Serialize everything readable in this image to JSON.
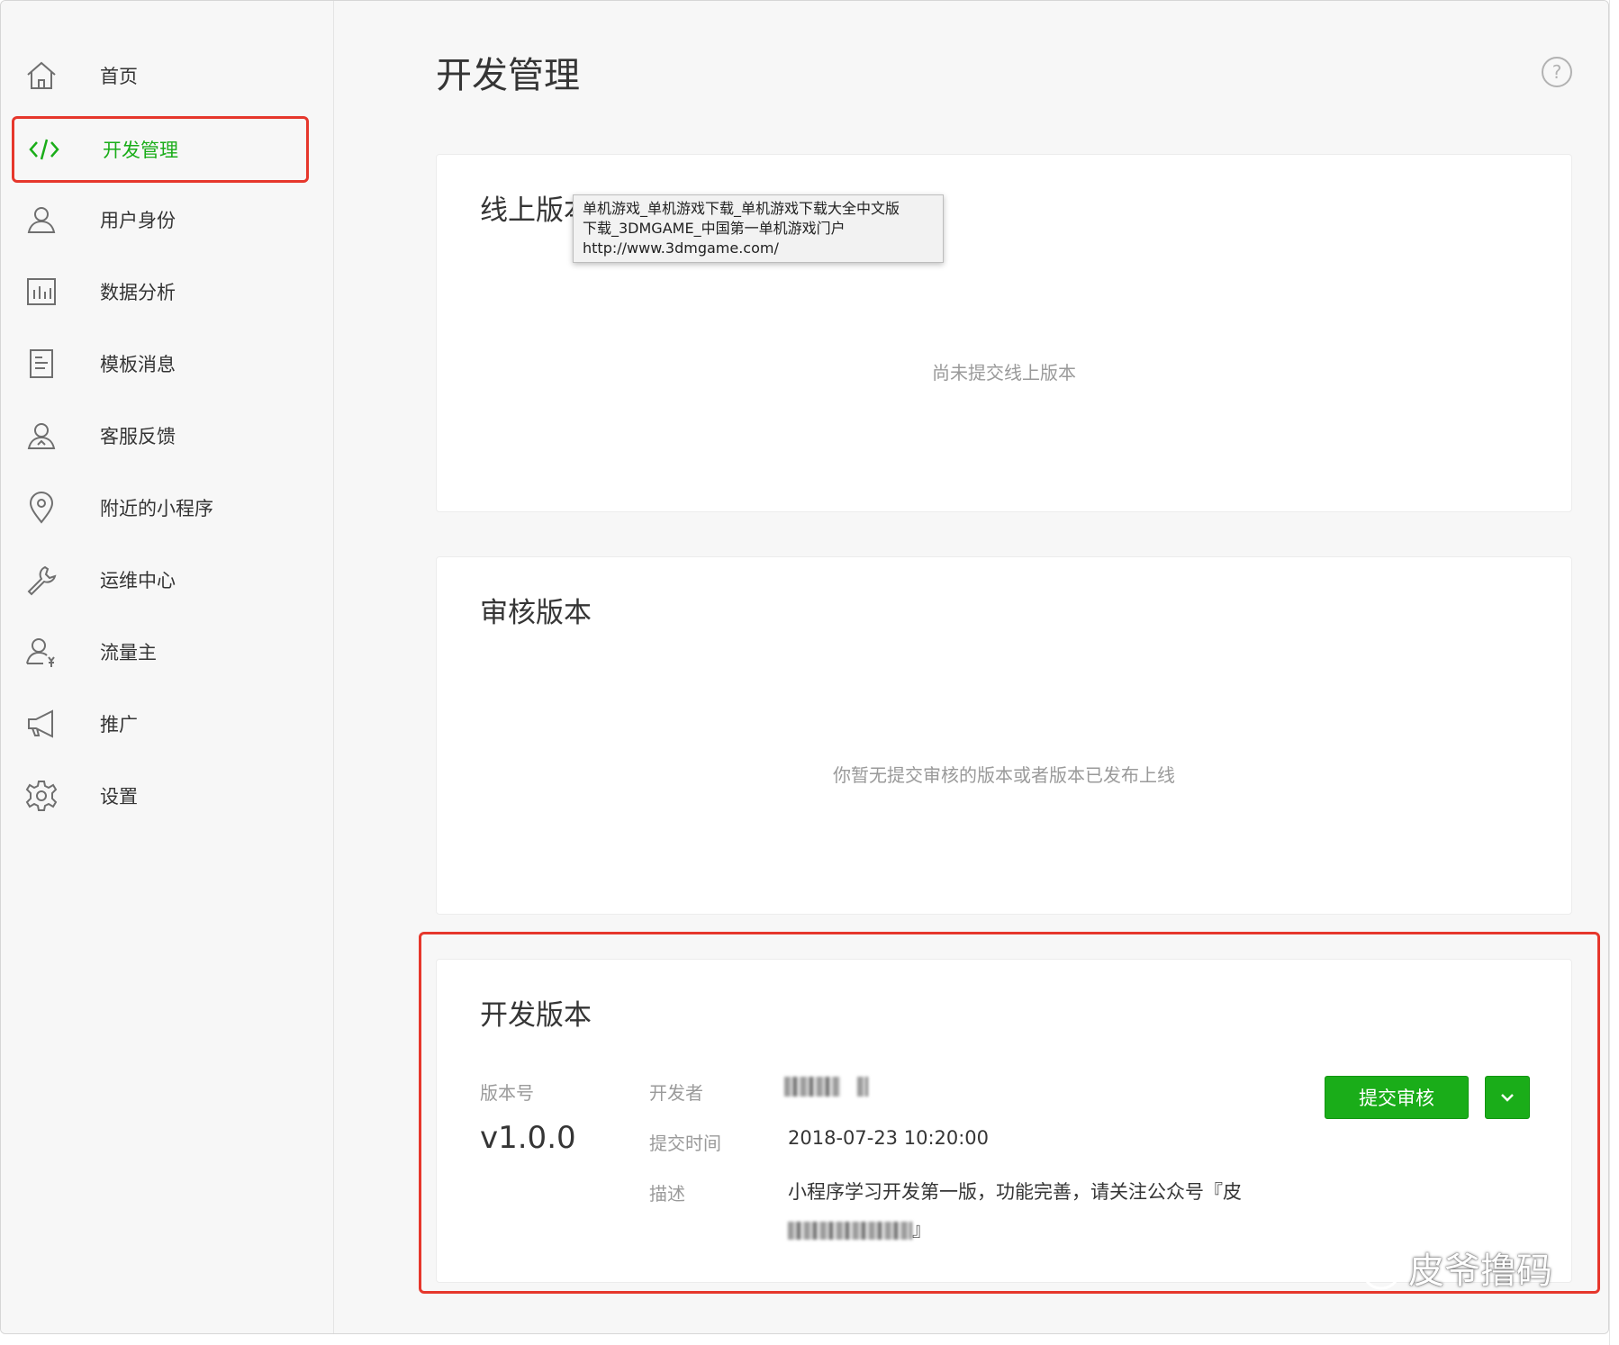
{
  "sidebar": {
    "items": [
      {
        "label": "首页",
        "icon": "home-icon"
      },
      {
        "label": "开发管理",
        "icon": "code-icon",
        "active": true
      },
      {
        "label": "用户身份",
        "icon": "user-icon"
      },
      {
        "label": "数据分析",
        "icon": "bar-chart-icon"
      },
      {
        "label": "模板消息",
        "icon": "document-icon"
      },
      {
        "label": "客服反馈",
        "icon": "customer-service-icon"
      },
      {
        "label": "附近的小程序",
        "icon": "location-pin-icon"
      },
      {
        "label": "运维中心",
        "icon": "wrench-icon"
      },
      {
        "label": "流量主",
        "icon": "user-yen-icon"
      },
      {
        "label": "推广",
        "icon": "megaphone-icon"
      },
      {
        "label": "设置",
        "icon": "gear-icon"
      }
    ]
  },
  "header": {
    "title": "开发管理",
    "help": "?"
  },
  "online": {
    "title": "线上版本",
    "empty": "尚未提交线上版本"
  },
  "tooltip": {
    "line1": "单机游戏_单机游戏下载_单机游戏下载大全中文版",
    "line2": "下载_3DMGAME_中国第一单机游戏门户",
    "line3": "http://www.3dmgame.com/"
  },
  "review": {
    "title": "审核版本",
    "empty": "你暂无提交审核的版本或者版本已发布上线"
  },
  "dev": {
    "title": "开发版本",
    "version_label": "版本号",
    "version": "v1.0.0",
    "developer_label": "开发者",
    "time_label": "提交时间",
    "time": "2018-07-23 10:20:00",
    "desc_label": "描述",
    "desc": "小程序学习开发第一版，功能完善，请关注公众号『皮",
    "desc_end": "』",
    "submit_label": "提交审核"
  },
  "watermark": {
    "text": "皮爷撸码"
  },
  "colors": {
    "accent": "#1aad19",
    "highlight": "#e6372c",
    "muted": "#9a9a9a"
  }
}
